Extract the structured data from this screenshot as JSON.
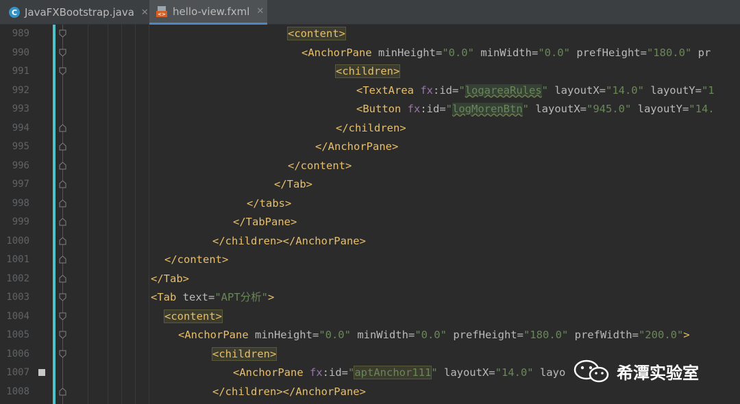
{
  "tabs": [
    {
      "label": "JavaFXBootstrap.java",
      "close": "✕",
      "icon": "java-class-icon",
      "active": false
    },
    {
      "label": "hello-view.fxml",
      "close": "✕",
      "icon": "fxml-file-icon",
      "active": true
    }
  ],
  "editor": {
    "lines": [
      {
        "n": "989",
        "indent": 20,
        "fold": "open",
        "tokens": [
          {
            "c": "t hl",
            "s": "<content>"
          }
        ]
      },
      {
        "n": "990",
        "indent": 22,
        "fold": "open",
        "tokens": [
          {
            "c": "t",
            "s": "<AnchorPane "
          },
          {
            "c": "a",
            "s": "minHeight="
          },
          {
            "c": "v",
            "s": "\"0.0\" "
          },
          {
            "c": "a",
            "s": "minWidth="
          },
          {
            "c": "v",
            "s": "\"0.0\" "
          },
          {
            "c": "a",
            "s": "prefHeight="
          },
          {
            "c": "v",
            "s": "\"180.0\" "
          },
          {
            "c": "a",
            "s": "pr"
          }
        ]
      },
      {
        "n": "991",
        "indent": 27,
        "fold": "open",
        "tokens": [
          {
            "c": "t hl",
            "s": "<children>"
          }
        ]
      },
      {
        "n": "992",
        "indent": 30,
        "fold": "",
        "tokens": [
          {
            "c": "t",
            "s": "<TextArea "
          },
          {
            "c": "p",
            "s": "fx"
          },
          {
            "c": "a",
            "s": ":id="
          },
          {
            "c": "v",
            "s": "\""
          },
          {
            "c": "v ib",
            "s": "logareaRules"
          },
          {
            "c": "v",
            "s": "\" "
          },
          {
            "c": "a",
            "s": "layoutX="
          },
          {
            "c": "v",
            "s": "\"14.0\" "
          },
          {
            "c": "a",
            "s": "layoutY="
          },
          {
            "c": "v",
            "s": "\"1"
          }
        ]
      },
      {
        "n": "993",
        "indent": 30,
        "fold": "",
        "tokens": [
          {
            "c": "t",
            "s": "<Button "
          },
          {
            "c": "p",
            "s": "fx"
          },
          {
            "c": "a",
            "s": ":id="
          },
          {
            "c": "v",
            "s": "\""
          },
          {
            "c": "v ib",
            "s": "logMorenBtn"
          },
          {
            "c": "v",
            "s": "\" "
          },
          {
            "c": "a",
            "s": "layoutX="
          },
          {
            "c": "v",
            "s": "\"945.0\" "
          },
          {
            "c": "a",
            "s": "layoutY="
          },
          {
            "c": "v",
            "s": "\"14."
          }
        ]
      },
      {
        "n": "994",
        "indent": 27,
        "fold": "close",
        "tokens": [
          {
            "c": "t",
            "s": "</children>"
          }
        ]
      },
      {
        "n": "995",
        "indent": 24,
        "fold": "close",
        "tokens": [
          {
            "c": "t",
            "s": "</AnchorPane>"
          }
        ]
      },
      {
        "n": "996",
        "indent": 20,
        "fold": "close",
        "tokens": [
          {
            "c": "t",
            "s": "</content>"
          }
        ]
      },
      {
        "n": "997",
        "indent": 18,
        "fold": "close",
        "tokens": [
          {
            "c": "t",
            "s": "</Tab>"
          }
        ]
      },
      {
        "n": "998",
        "indent": 14,
        "fold": "close",
        "tokens": [
          {
            "c": "t",
            "s": "</tabs>"
          }
        ]
      },
      {
        "n": "999",
        "indent": 12,
        "fold": "close",
        "tokens": [
          {
            "c": "t",
            "s": "</TabPane>"
          }
        ]
      },
      {
        "n": "1000",
        "indent": 9,
        "fold": "close",
        "tokens": [
          {
            "c": "t",
            "s": "</children></AnchorPane>"
          }
        ]
      },
      {
        "n": "1001",
        "indent": 2,
        "fold": "close",
        "tokens": [
          {
            "c": "t",
            "s": "</content>"
          }
        ]
      },
      {
        "n": "1002",
        "indent": 0,
        "fold": "close",
        "tokens": [
          {
            "c": "t",
            "s": "</Tab>"
          }
        ]
      },
      {
        "n": "1003",
        "indent": 0,
        "fold": "open",
        "tokens": [
          {
            "c": "t",
            "s": "<Tab "
          },
          {
            "c": "a",
            "s": "text="
          },
          {
            "c": "v",
            "s": "\"APT分析\""
          },
          {
            "c": "t",
            "s": ">"
          }
        ]
      },
      {
        "n": "1004",
        "indent": 2,
        "fold": "open",
        "tokens": [
          {
            "c": "t hl",
            "s": "<content>"
          }
        ]
      },
      {
        "n": "1005",
        "indent": 4,
        "fold": "open",
        "tokens": [
          {
            "c": "t",
            "s": "<AnchorPane "
          },
          {
            "c": "a",
            "s": "minHeight="
          },
          {
            "c": "v",
            "s": "\"0.0\" "
          },
          {
            "c": "a",
            "s": "minWidth="
          },
          {
            "c": "v",
            "s": "\"0.0\" "
          },
          {
            "c": "a",
            "s": "prefHeight="
          },
          {
            "c": "v",
            "s": "\"180.0\" "
          },
          {
            "c": "a",
            "s": "prefWidth="
          },
          {
            "c": "v",
            "s": "\"200.0\""
          },
          {
            "c": "t",
            "s": ">"
          }
        ]
      },
      {
        "n": "1006",
        "indent": 9,
        "fold": "open",
        "tokens": [
          {
            "c": "t hl",
            "s": "<children>"
          }
        ]
      },
      {
        "n": "1007",
        "indent": 12,
        "fold": "",
        "bookmark": true,
        "tokens": [
          {
            "c": "t",
            "s": "<AnchorPane "
          },
          {
            "c": "p",
            "s": "fx"
          },
          {
            "c": "a",
            "s": ":id="
          },
          {
            "c": "v",
            "s": "\""
          },
          {
            "c": "v hl",
            "s": "aptAnchor111"
          },
          {
            "c": "v",
            "s": "\" "
          },
          {
            "c": "a",
            "s": "layoutX="
          },
          {
            "c": "v",
            "s": "\"14.0\" "
          },
          {
            "c": "a",
            "s": "layo"
          }
        ]
      },
      {
        "n": "1008",
        "indent": 9,
        "fold": "close",
        "tokens": [
          {
            "c": "t",
            "s": "</children></AnchorPane>"
          }
        ]
      }
    ]
  },
  "watermark": {
    "text": "希潭实验室",
    "icon": "wechat-icon"
  }
}
